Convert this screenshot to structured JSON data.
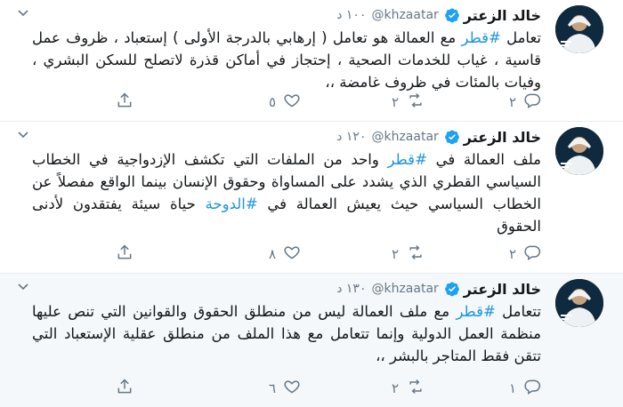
{
  "tweets": [
    {
      "name": "خالد الزعتر",
      "handle": "@khzaatar",
      "time": "١٠٠ د",
      "text_before": "تعامل ",
      "hashtag": "#قطر",
      "text_after": " مع العمالة هو تعامل ( إرهابي بالدرجة الأولى ) إستعباد ، ظروف عمل قاسية ، غياب للخدمات الصحية ، إحتجاز في أماكن قذرة لاتصلح للسكن البشري ، وفيات بالمئات في ظروف غامضة ،،",
      "replies": "٢",
      "retweets": "٢",
      "likes": "٥"
    },
    {
      "name": "خالد الزعتر",
      "handle": "@khzaatar",
      "time": "١٢٠ د",
      "text_before": "ملف العمالة في ",
      "hashtag": "#قطر",
      "text_middle": " واحد من الملفات التي تكشف الإزدواجية في الخطاب السياسي القطري الذي يشدد على المساواة وحقوق الإنسان بينما الواقع مفصلاً عن الخطاب السياسي حيث يعيش العمالة في ",
      "hashtag2": "#الدوحة",
      "text_after": " حياة سيئة يفتقدون لأدنى الحقوق",
      "replies": "٢",
      "retweets": "٢",
      "likes": "٨"
    },
    {
      "name": "خالد الزعتر",
      "handle": "@khzaatar",
      "time": "١٣٠ د",
      "text_before": "تتعامل ",
      "hashtag": "#قطر",
      "text_after": " مع ملف العمالة ليس من منطلق الحقوق والقوانين التي تنص عليها منظمة العمل الدولية وإنما تتعامل مع هذا الملف من منطلق عقلية الإستعباد التي تتقن فقط المتاجر بالبشر ،،",
      "replies": "١",
      "retweets": "٢",
      "likes": "٦"
    }
  ],
  "colors": {
    "accent": "#1b95e0",
    "muted": "#657786",
    "text": "#14171a",
    "highlight_bg": "#f5f8fa"
  },
  "icons": [
    "verified-badge-icon",
    "caret-down-icon",
    "reply-icon",
    "retweet-icon",
    "like-icon",
    "share-icon"
  ]
}
